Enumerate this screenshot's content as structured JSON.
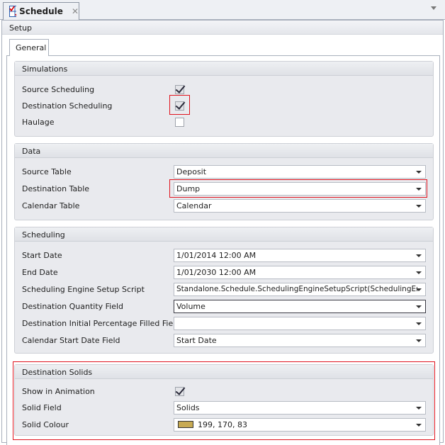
{
  "document_tab": {
    "title": "Schedule",
    "icon": "schedule-grid-check-icon",
    "close": "✕"
  },
  "section": "Setup",
  "page_tab": "General",
  "highlight_color": "#e0141e",
  "groups": {
    "simulations": {
      "title": "Simulations",
      "rows": [
        {
          "label": "Source Scheduling",
          "checked": true
        },
        {
          "label": "Destination Scheduling",
          "checked": true
        },
        {
          "label": "Haulage",
          "checked": false
        }
      ]
    },
    "data": {
      "title": "Data",
      "rows": [
        {
          "label": "Source Table",
          "value": "Deposit"
        },
        {
          "label": "Destination Table",
          "value": "Dump"
        },
        {
          "label": "Calendar Table",
          "value": "Calendar"
        }
      ]
    },
    "scheduling": {
      "title": "Scheduling",
      "rows": [
        {
          "label": "Start Date",
          "value": "1/01/2014 12:00 AM"
        },
        {
          "label": "End Date",
          "value": "1/01/2030 12:00 AM"
        },
        {
          "label": "Scheduling Engine Setup Script",
          "value": "Standalone.Schedule.SchedulingEngineSetupScript(SchedulingEngine)"
        },
        {
          "label": "Destination Quantity Field",
          "value": "Volume"
        },
        {
          "label": "Destination Initial Percentage Filled Field",
          "value": ""
        },
        {
          "label": "Calendar Start Date Field",
          "value": "Start Date"
        }
      ]
    },
    "solids": {
      "title": "Destination Solids",
      "rows": [
        {
          "label": "Show in Animation",
          "checked": true
        },
        {
          "label": "Solid Field",
          "value": "Solids"
        },
        {
          "label": "Solid Colour",
          "value": "199, 170, 83",
          "color": "#c7aa53"
        }
      ]
    }
  }
}
